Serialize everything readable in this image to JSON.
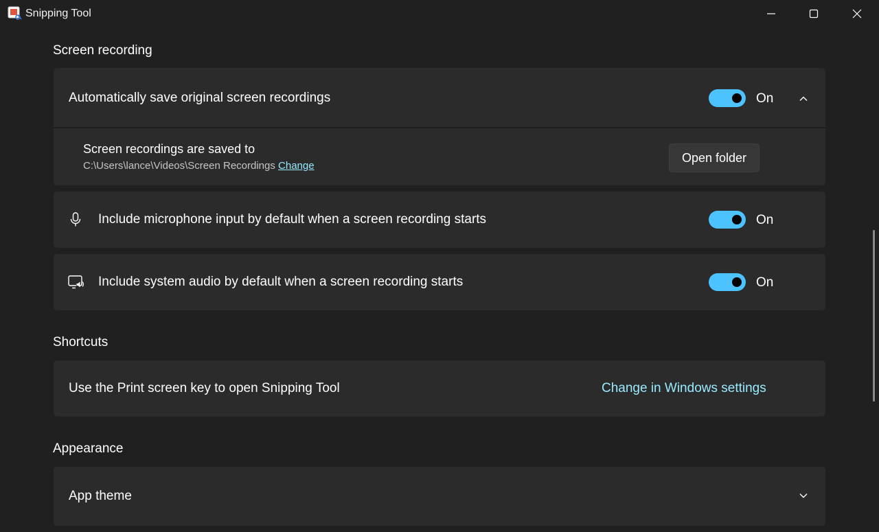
{
  "window": {
    "title": "Snipping Tool"
  },
  "screen_recording": {
    "section_title": "Screen recording",
    "auto_save": {
      "label": "Automatically save original screen recordings",
      "state": "On",
      "toggle_on": true,
      "expanded": true
    },
    "save_location": {
      "title": "Screen recordings are saved to",
      "path": "C:\\Users\\lance\\Videos\\Screen Recordings",
      "change_link": "Change",
      "open_folder_label": "Open folder"
    },
    "microphone": {
      "label": "Include microphone input by default when a screen recording starts",
      "state": "On",
      "toggle_on": true,
      "icon": "microphone-icon"
    },
    "system_audio": {
      "label": "Include system audio by default when a screen recording starts",
      "state": "On",
      "toggle_on": true,
      "icon": "system-audio-icon"
    }
  },
  "shortcuts": {
    "section_title": "Shortcuts",
    "print_screen": {
      "label": "Use the Print screen key to open Snipping Tool",
      "link": "Change in Windows settings"
    }
  },
  "appearance": {
    "section_title": "Appearance",
    "app_theme": {
      "label": "App theme"
    }
  },
  "colors": {
    "background": "#202020",
    "card": "#2b2b2b",
    "accent": "#4cc2ff",
    "link": "#99ebff"
  }
}
